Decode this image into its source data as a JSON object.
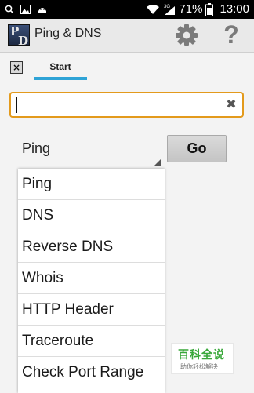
{
  "status_bar": {
    "battery_text": "71%",
    "time": "13:00",
    "icons": [
      "search-icon",
      "image-icon",
      "android-icon",
      "wifi-icon",
      "signal-icon",
      "battery-icon"
    ],
    "network_label": "3G"
  },
  "action_bar": {
    "app_icon_letters": [
      "P",
      "D"
    ],
    "title": "Ping & DNS",
    "settings_icon": "gear-icon",
    "help_label": "?"
  },
  "tabs": {
    "close_label": "×",
    "items": [
      {
        "label": "Start",
        "selected": true
      }
    ],
    "accent": "#2ea3d6"
  },
  "host_input": {
    "value": "",
    "placeholder": "",
    "clear_label": "✖",
    "border_color": "#e39a1c"
  },
  "spinner": {
    "selected": "Ping"
  },
  "go_button": {
    "label": "Go"
  },
  "dropdown": {
    "options": [
      "Ping",
      "DNS",
      "Reverse DNS",
      "Whois",
      "HTTP Header",
      "Traceroute",
      "Check Port Range"
    ]
  },
  "watermark": {
    "title": "百科全说",
    "subtitle": "助你轻松解决"
  }
}
